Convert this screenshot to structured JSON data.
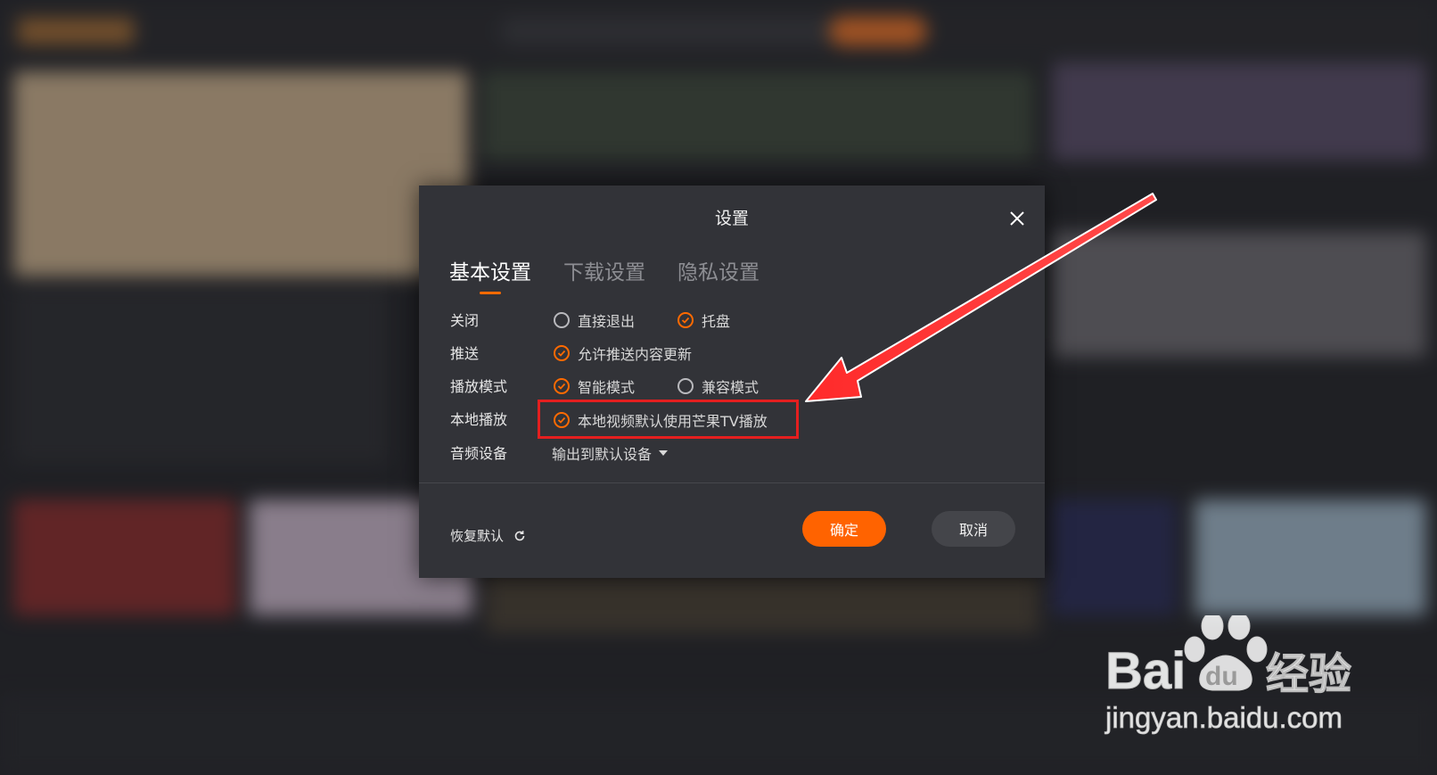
{
  "dialog": {
    "title": "设置",
    "tabs": [
      {
        "label": "基本设置",
        "active": true
      },
      {
        "label": "下载设置",
        "active": false
      },
      {
        "label": "隐私设置",
        "active": false
      }
    ],
    "rows": {
      "close": {
        "label": "关闭",
        "options": [
          {
            "label": "直接退出",
            "checked": false
          },
          {
            "label": "托盘",
            "checked": true
          }
        ]
      },
      "push": {
        "label": "推送",
        "options": [
          {
            "label": "允许推送内容更新",
            "checked": true
          }
        ]
      },
      "play_mode": {
        "label": "播放模式",
        "options": [
          {
            "label": "智能模式",
            "checked": true
          },
          {
            "label": "兼容模式",
            "checked": false
          }
        ]
      },
      "local_play": {
        "label": "本地播放",
        "options": [
          {
            "label": "本地视频默认使用芒果TV播放",
            "checked": true
          }
        ]
      },
      "audio_device": {
        "label": "音频设备",
        "selected": "输出到默认设备"
      }
    },
    "restore_label": "恢复默认",
    "ok_label": "确定",
    "cancel_label": "取消"
  },
  "watermark": {
    "brand": "Bai du 经验",
    "url": "jingyan.baidu.com"
  },
  "colors": {
    "accent": "#ff6300",
    "dialog_bg": "#323338",
    "annotation_red": "#e41f1f"
  }
}
